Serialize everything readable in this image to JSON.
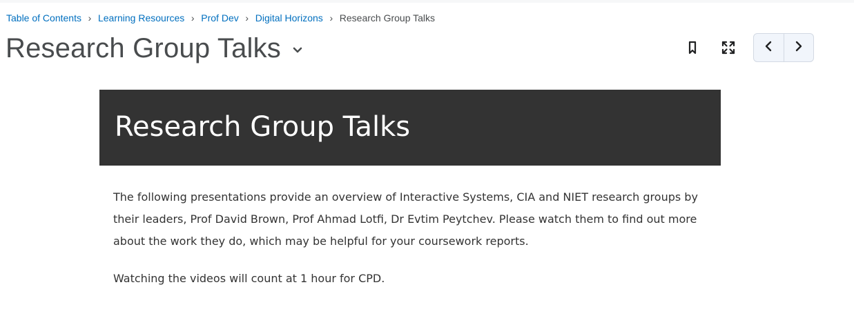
{
  "breadcrumb": {
    "items": [
      "Table of Contents",
      "Learning Resources",
      "Prof Dev",
      "Digital Horizons"
    ],
    "current": "Research Group Talks",
    "separator": "›"
  },
  "page": {
    "title": "Research Group Talks"
  },
  "toolbar": {
    "bookmark_icon": "bookmark-icon",
    "fullscreen_icon": "fullscreen-icon",
    "previous_icon": "chevron-left-icon",
    "next_icon": "chevron-right-icon"
  },
  "content": {
    "banner_title": "Research Group Talks",
    "paragraph_1_line_1": "The following presentations provide an overview of Interactive Systems, CIA and NIET research groups by",
    "paragraph_1_line_2": "their leaders, Prof David Brown, Prof Ahmad Lotfi, Dr Evtim Peytchev. Please watch them to find out more",
    "paragraph_1_line_3": "about the work they do, which may be helpful for your coursework reports.",
    "paragraph_2": "Watching the videos will count at 1 hour for CPD."
  },
  "colors": {
    "link": "#006fbf",
    "text": "#494c4e",
    "banner_bg": "#333333",
    "banner_text": "#ffffff"
  }
}
